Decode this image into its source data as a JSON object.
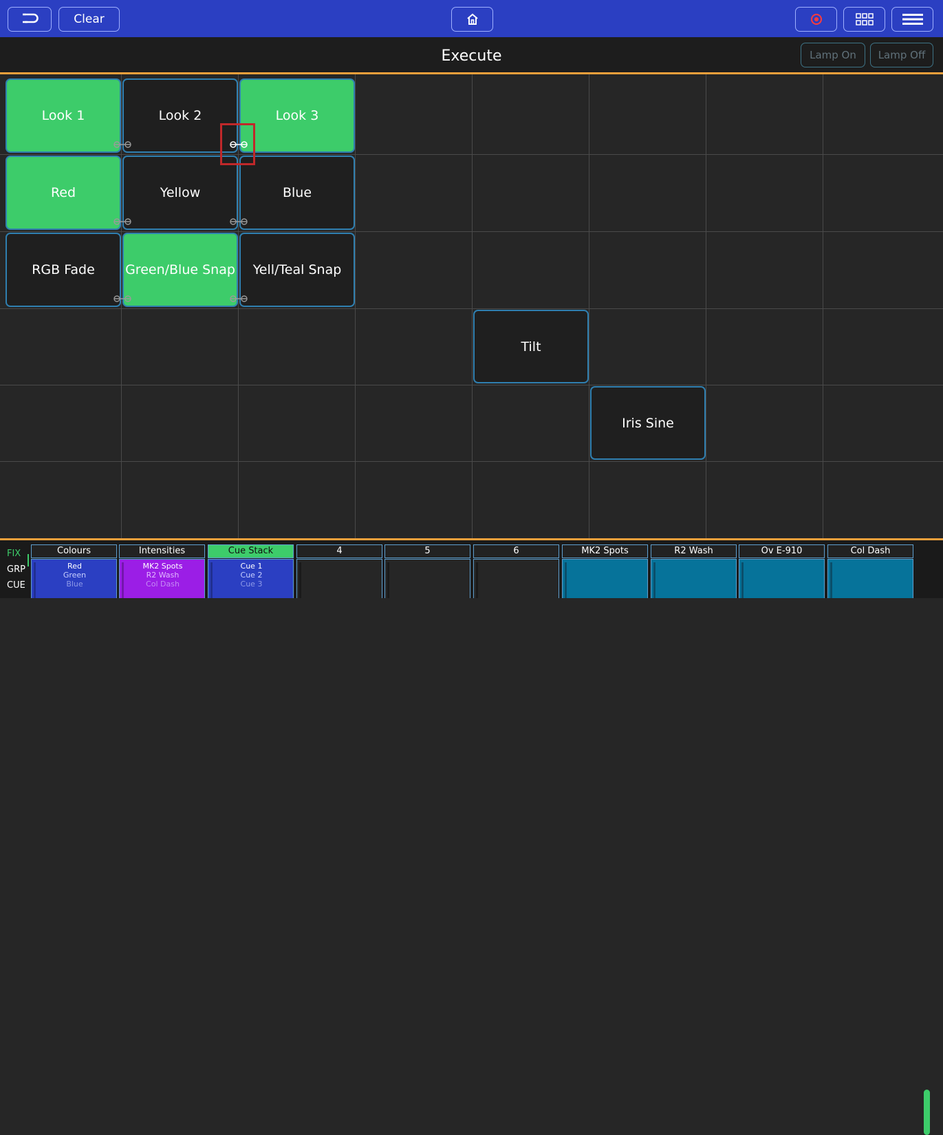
{
  "topbar": {
    "back_icon": "return-arrow-icon",
    "clear_label": "Clear",
    "home_icon": "home-icon",
    "record_icon": "record-icon",
    "grid_icon": "grid-view-icon",
    "menu_icon": "hamburger-menu-icon"
  },
  "header": {
    "title": "Execute",
    "lamp_on": "Lamp On",
    "lamp_off": "Lamp Off"
  },
  "execute": {
    "cells": [
      {
        "label": "Look 1",
        "active": true
      },
      {
        "label": "Look 2",
        "active": false
      },
      {
        "label": "Look 3",
        "active": true
      },
      {
        "label": "Red",
        "active": true
      },
      {
        "label": "Yellow",
        "active": false
      },
      {
        "label": "Blue",
        "active": false
      },
      {
        "label": "RGB Fade",
        "active": false
      },
      {
        "label": "Green/Blue Snap",
        "active": true
      },
      {
        "label": "Yell/Teal Snap",
        "active": false
      },
      {
        "label": "Tilt",
        "active": false
      },
      {
        "label": "Iris Sine",
        "active": false
      }
    ],
    "link_icon": "link-chain-icon"
  },
  "modes": [
    "FIX",
    "GRP",
    "CUE"
  ],
  "playbacks": [
    {
      "title": "Colours",
      "lines": [
        "Red",
        "Green",
        "Blue"
      ],
      "color": "#2b3fc2"
    },
    {
      "title": "Intensities",
      "lines": [
        "MK2 Spots",
        "R2 Wash",
        "Col Dash"
      ],
      "color": "#9b1ee6"
    },
    {
      "title": "Cue Stack",
      "lines": [
        "Cue 1",
        "Cue 2",
        "Cue 3"
      ],
      "color": "#2b3fc2",
      "active": true
    },
    {
      "title": "4",
      "lines": [],
      "color": ""
    },
    {
      "title": "5",
      "lines": [],
      "color": ""
    },
    {
      "title": "6",
      "lines": [],
      "color": ""
    },
    {
      "title": "MK2 Spots",
      "lines": [],
      "color": "#06739a"
    },
    {
      "title": "R2 Wash",
      "lines": [],
      "color": "#06739a"
    },
    {
      "title": "Ov E-910",
      "lines": [],
      "color": "#06739a"
    },
    {
      "title": "Col Dash",
      "lines": [],
      "color": "#06739a"
    }
  ],
  "colors": {
    "topbar": "#2b3fc2",
    "active_cell": "#3dcc6a",
    "accent_line": "#f2a03b",
    "cell_border": "#2f7fb0",
    "highlight": "#c0282a"
  }
}
